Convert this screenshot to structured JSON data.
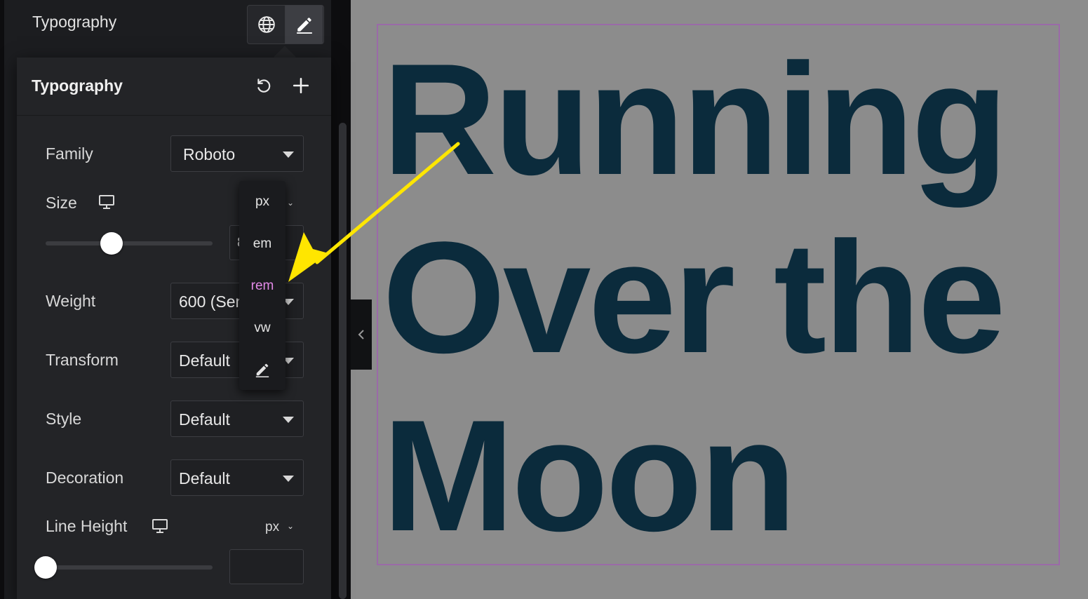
{
  "panel": {
    "control_title": "Typography",
    "popover_title": "Typography",
    "fields": {
      "family": {
        "label": "Family",
        "value": "Roboto"
      },
      "size": {
        "label": "Size",
        "unit": "px",
        "value": "8"
      },
      "weight": {
        "label": "Weight",
        "value": "600 (Semi Bold)"
      },
      "transform": {
        "label": "Transform",
        "value": "Default"
      },
      "style": {
        "label": "Style",
        "value": "Default"
      },
      "decoration": {
        "label": "Decoration",
        "value": "Default"
      },
      "line_height": {
        "label": "Line Height",
        "unit": "px",
        "value": ""
      }
    },
    "unit_menu": {
      "options": [
        "em",
        "rem",
        "vw"
      ],
      "highlighted": "rem"
    }
  },
  "canvas": {
    "heading_lines": [
      "Running",
      "Over the",
      "Moon"
    ],
    "heading_color": "#0b2b3c"
  },
  "colors": {
    "accent": "#e38ae8",
    "annotation_arrow": "#ffe600",
    "panel_bg": "#1c1d20",
    "canvas_bg": "#8c8c8c",
    "frame": "#9a6aa8"
  },
  "icons": [
    "globe-icon",
    "pencil-icon",
    "reset-icon",
    "plus-icon",
    "desktop-icon",
    "chevron-down-icon",
    "chevron-left-icon"
  ]
}
